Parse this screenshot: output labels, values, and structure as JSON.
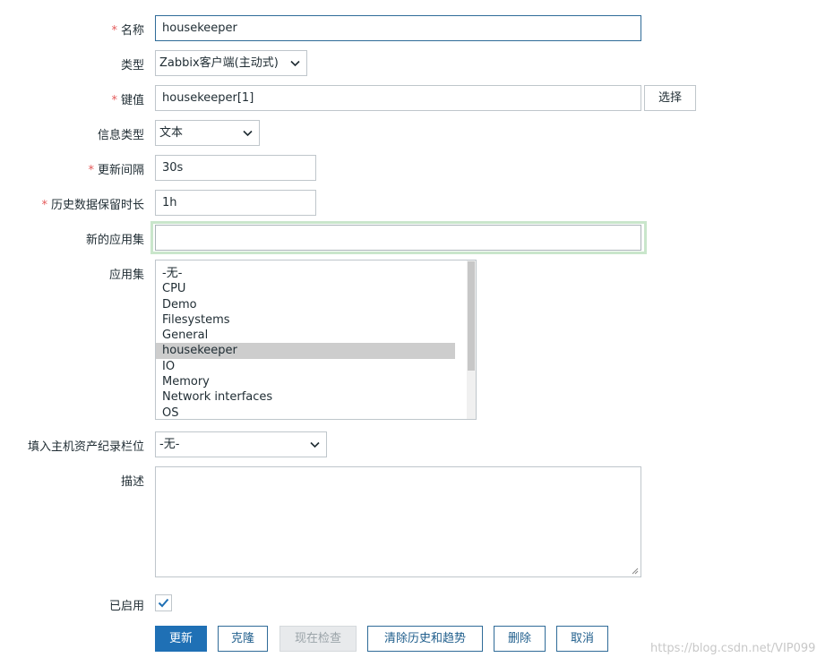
{
  "form": {
    "name": {
      "label": "名称",
      "value": "housekeeper"
    },
    "type": {
      "label": "类型",
      "value": "Zabbix客户端(主动式)"
    },
    "key": {
      "label": "键值",
      "value": "housekeeper[1]",
      "select_button": "选择"
    },
    "info_type": {
      "label": "信息类型",
      "value": "文本"
    },
    "interval": {
      "label": "更新间隔",
      "value": "30s"
    },
    "history": {
      "label": "历史数据保留时长",
      "value": "1h"
    },
    "new_app": {
      "label": "新的应用集",
      "value": ""
    },
    "apps": {
      "label": "应用集",
      "items": [
        "-无-",
        "CPU",
        "Demo",
        "Filesystems",
        "General",
        "housekeeper",
        "IO",
        "Memory",
        "Network interfaces",
        "OS"
      ],
      "selected": "housekeeper"
    },
    "inventory": {
      "label": "填入主机资产纪录栏位",
      "value": "-无-"
    },
    "description": {
      "label": "描述",
      "value": ""
    },
    "enabled": {
      "label": "已启用",
      "checked": true
    },
    "required_mark": "*"
  },
  "buttons": {
    "update": "更新",
    "clone": "克隆",
    "check_now": "现在检查",
    "clear_history": "清除历史和趋势",
    "delete": "删除",
    "cancel": "取消"
  },
  "watermark": "https://blog.csdn.net/VIP099",
  "colors": {
    "primary": "#1f70b5",
    "required": "#e45959",
    "focus_glow": "#c9e6cb"
  }
}
